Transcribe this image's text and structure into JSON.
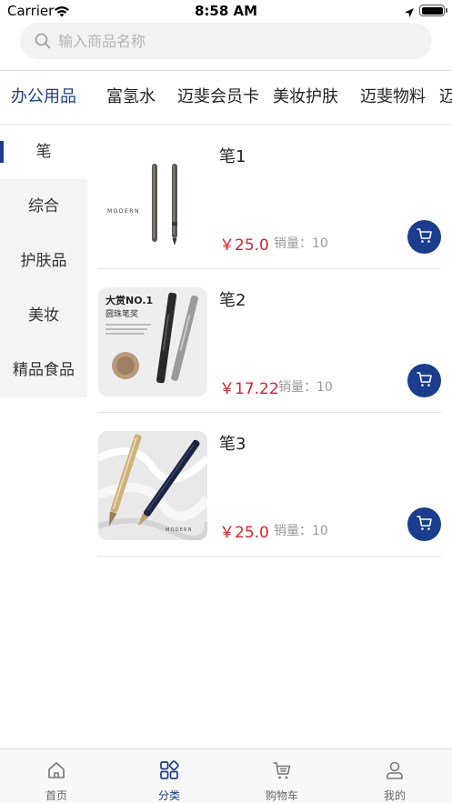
{
  "status_bar": {
    "carrier": "Carrier",
    "time": "8:58 AM"
  },
  "search": {
    "placeholder": "输入商品名称"
  },
  "categories": [
    {
      "label": "办公用品",
      "active": true
    },
    {
      "label": "富氢水",
      "active": false
    },
    {
      "label": "迈斐会员卡",
      "active": false
    },
    {
      "label": "美妆护肤",
      "active": false
    },
    {
      "label": "迈斐物料",
      "active": false
    },
    {
      "label": "迈",
      "active": false
    }
  ],
  "subcategories": [
    {
      "label": "笔",
      "active": true
    },
    {
      "label": "综合",
      "active": false
    },
    {
      "label": "护肤品",
      "active": false
    },
    {
      "label": "美妆",
      "active": false
    },
    {
      "label": "精品食品",
      "active": false
    }
  ],
  "products": [
    {
      "name": "笔1",
      "price": "￥25.0",
      "sales": "销量：10",
      "image_text": "MODERN"
    },
    {
      "name": "笔2",
      "price": "￥17.22",
      "sales": "销量：10",
      "image_text": "大赏NO.1",
      "image_subtext": "圆珠笔奖"
    },
    {
      "name": "笔3",
      "price": "￥25.0",
      "sales": "销量：10",
      "image_text": "MODERN"
    }
  ],
  "tabbar": [
    {
      "label": "首页",
      "icon": "home-icon",
      "active": false
    },
    {
      "label": "分类",
      "icon": "category-icon",
      "active": true
    },
    {
      "label": "购物车",
      "icon": "cart-icon",
      "active": false
    },
    {
      "label": "我的",
      "icon": "user-icon",
      "active": false
    }
  ],
  "colors": {
    "accent": "#1a3d8f",
    "price": "#e0202a"
  }
}
